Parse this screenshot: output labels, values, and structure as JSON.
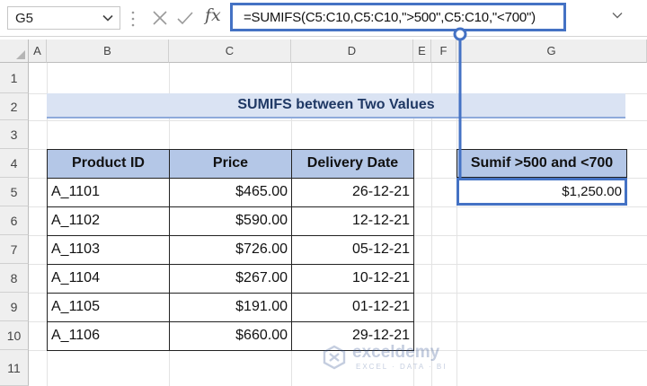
{
  "formula_bar": {
    "name_box": "G5",
    "fx_label": "fx",
    "formula": "=SUMIFS(C5:C10,C5:C10,\">500\",C5:C10,\"<700\")"
  },
  "columns": [
    "A",
    "B",
    "C",
    "D",
    "E",
    "F",
    "G"
  ],
  "rows": [
    "1",
    "2",
    "3",
    "4",
    "5",
    "6",
    "7",
    "8",
    "9",
    "10",
    "11"
  ],
  "title": "SUMIFS between Two Values",
  "table": {
    "headers": [
      "Product ID",
      "Price",
      "Delivery Date"
    ],
    "rows": [
      [
        "A_1101",
        "$465.00",
        "26-12-21"
      ],
      [
        "A_1102",
        "$590.00",
        "12-12-21"
      ],
      [
        "A_1103",
        "$726.00",
        "05-12-21"
      ],
      [
        "A_1104",
        "$267.00",
        "10-12-21"
      ],
      [
        "A_1105",
        "$191.00",
        "01-12-21"
      ],
      [
        "A_1106",
        "$660.00",
        "29-12-21"
      ]
    ]
  },
  "result": {
    "header": "Sumif >500 and <700",
    "value": "$1,250.00"
  },
  "colors": {
    "accent": "#4472c4",
    "header_fill": "#b4c7e7",
    "title_fill": "#dae3f3"
  },
  "watermark": {
    "name": "exceldemy",
    "tagline": "EXCEL · DATA · BI"
  }
}
